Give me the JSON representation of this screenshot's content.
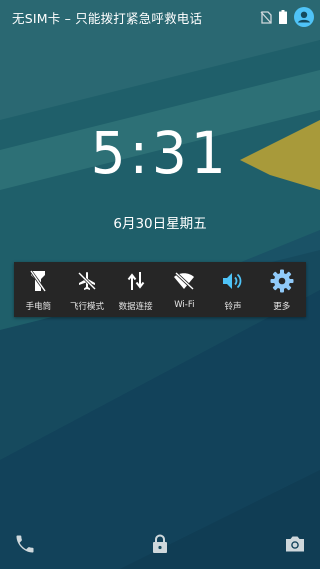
{
  "status_bar": {
    "carrier_text": "无SIM卡 – 只能拨打紧急呼救电话",
    "icons": [
      "no-sim-icon",
      "battery-icon",
      "user-avatar-icon"
    ]
  },
  "lockscreen": {
    "time": "5:31",
    "date": "6月30日星期五"
  },
  "quick_settings": {
    "tiles": [
      {
        "label": "手电筒",
        "icon": "flashlight-icon",
        "active": false
      },
      {
        "label": "飞行模式",
        "icon": "airplane-mode-icon",
        "active": false
      },
      {
        "label": "数据连接",
        "icon": "data-connection-icon",
        "active": false
      },
      {
        "label": "Wi-Fi",
        "icon": "wifi-off-icon",
        "active": false
      },
      {
        "label": "铃声",
        "icon": "ringer-icon",
        "active": true
      },
      {
        "label": "更多",
        "icon": "settings-gear-icon",
        "active": false
      }
    ]
  },
  "bottom_shortcuts": [
    "phone-icon",
    "lock-icon",
    "camera-icon"
  ],
  "colors": {
    "active_accent": "#4fc3f7",
    "panel_bg": "#262626",
    "wallpaper_base": "#154a5e"
  }
}
